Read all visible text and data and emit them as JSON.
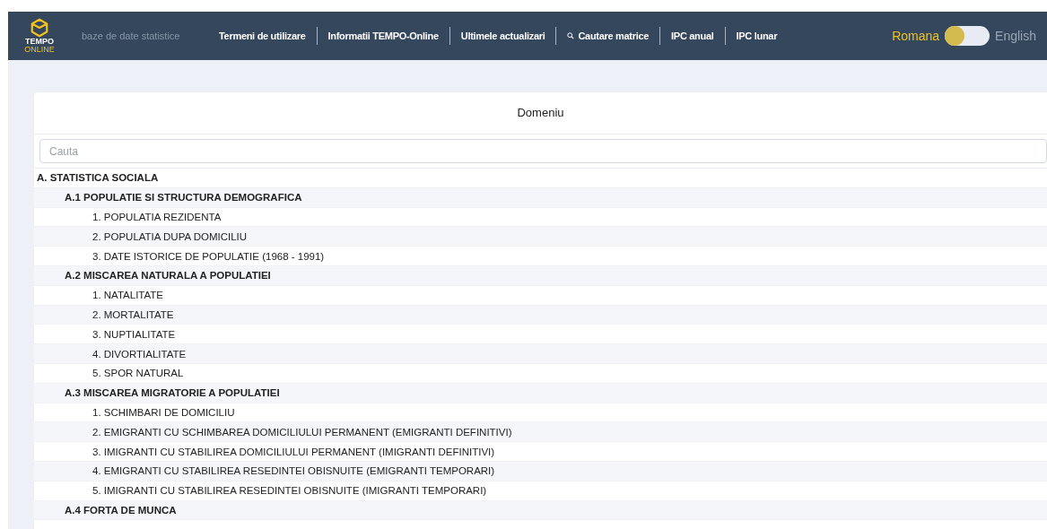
{
  "header": {
    "logo_top": "TEMPO",
    "logo_bottom": "ONLINE",
    "tagline": "baze de date statistice",
    "nav": [
      {
        "label": "Termeni de utilizare",
        "kind": "link"
      },
      {
        "label": "Informatii TEMPO-Online",
        "kind": "link"
      },
      {
        "label": "Ultimele actualizari",
        "kind": "link"
      },
      {
        "label": "Cautare matrice",
        "kind": "search"
      },
      {
        "label": "IPC anual",
        "kind": "link"
      },
      {
        "label": "IPC lunar",
        "kind": "link"
      }
    ],
    "languages": [
      {
        "label": "Romana",
        "selected": true
      },
      {
        "label": "English",
        "selected": false
      }
    ]
  },
  "panel": {
    "title": "Domeniu",
    "search": {
      "placeholder": "Cauta"
    },
    "tree": [
      {
        "label": "A. STATISTICA SOCIALA",
        "children": [
          {
            "label": "A.1 POPULATIE SI STRUCTURA DEMOGRAFICA",
            "children": [
              {
                "label": "1. POPULATIA REZIDENTA"
              },
              {
                "label": "2. POPULATIA DUPA DOMICILIU"
              },
              {
                "label": "3. DATE ISTORICE DE POPULATIE (1968 - 1991)"
              }
            ]
          },
          {
            "label": "A.2 MISCAREA NATURALA A POPULATIEI",
            "children": [
              {
                "label": "1. NATALITATE"
              },
              {
                "label": "2. MORTALITATE"
              },
              {
                "label": "3. NUPTIALITATE"
              },
              {
                "label": "4. DIVORTIALITATE"
              },
              {
                "label": "5. SPOR NATURAL"
              }
            ]
          },
          {
            "label": "A.3 MISCAREA MIGRATORIE A POPULATIEI",
            "children": [
              {
                "label": "1. SCHIMBARI DE DOMICILIU"
              },
              {
                "label": "2. EMIGRANTI CU SCHIMBAREA DOMICILIULUI PERMANENT (EMIGRANTI DEFINITIVI)"
              },
              {
                "label": "3. IMIGRANTI CU STABILIREA DOMICILIULUI PERMANENT (IMIGRANTI DEFINITIVI)"
              },
              {
                "label": "4. EMIGRANTI CU STABILIREA RESEDINTEI OBISNUITE (EMIGRANTI TEMPORARI)"
              },
              {
                "label": "5. IMIGRANTI CU STABILIREA RESEDINTEI OBISNUITE (IMIGRANTI TEMPORARI)"
              }
            ]
          },
          {
            "label": "A.4 FORTA DE MUNCA"
          }
        ]
      }
    ]
  }
}
